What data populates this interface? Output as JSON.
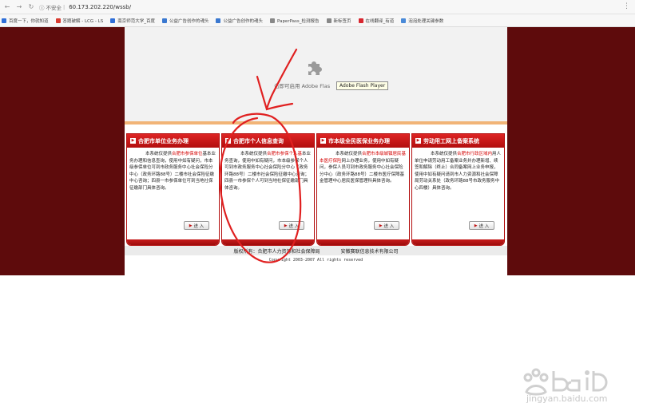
{
  "browser": {
    "security_label": "不安全",
    "url": "60.173.202.220/wssb/",
    "bookmarks": [
      {
        "label": "百度一下，你就知道",
        "color": "#2f6fd8"
      },
      {
        "label": "答题破解 - LCG - LS",
        "color": "#d83a2f"
      },
      {
        "label": "南京师范大学_百度",
        "color": "#2f6fd8"
      },
      {
        "label": "公益广告创作的魂头",
        "color": "#3a78d0"
      },
      {
        "label": "公益广告创作的魂头",
        "color": "#3a78d0"
      },
      {
        "label": "PaperPass_检测报告",
        "color": "#888888"
      },
      {
        "label": "新标签页",
        "color": "#888888"
      },
      {
        "label": "在线翻译_有道",
        "color": "#d8262f"
      },
      {
        "label": "泡泡处理关键参数",
        "color": "#4a8ad8"
      }
    ]
  },
  "flash": {
    "text": "击即可启用 Adobe Flas",
    "tooltip": "Adobe Flash Player"
  },
  "panels": [
    {
      "title": "合肥市单位业务办理",
      "body_pre": "本系统仅提供",
      "body_highlight": "合肥市参保单位",
      "body_post": "基本业务办理和信息查询，使用中如有疑问，市本级参保单位可到市政务服务中心社会保险分中心（政务环路88号）二楼市社会保险征缴中心咨询；四县一市参保单位可到当地社保征缴部门具体咨询。",
      "button": "进 入"
    },
    {
      "title": "合肥市个人信息查询",
      "body_pre": "本系统仅提供",
      "body_highlight": "合肥市参保个人基",
      "body_post": "本业务查询，使用中如有疑问，市本级参保个人可到市政务服务中心社会保险分中心（政务环路88号）二楼市社会保险征缴中心咨询；四县一市参保个人可到当地社保征缴部门具体咨询。",
      "button": "进 入"
    },
    {
      "title": "市本级全民医保业务办理",
      "body_pre": "本系统仅提供",
      "body_highlight": "合肥市本级城镇居民基本医疗保险",
      "body_post": "网上办理业务，使用中如有疑问，参保人员可到市政务服务中心社会保险分中心（政务环路88号）二楼市医疗保障基金管理中心居民医保管理科具体咨询。",
      "button": "进 入"
    },
    {
      "title": "劳动用工网上备案系统",
      "body_pre": "本系统仅提供",
      "body_highlight": "合肥市行政区域内",
      "body_post": "用人单位申请劳动用工备案业务并办理新增、续签和解除（终止）合同备案网上业务申报，使用中如有疑问请到市人力资源和社会保障局劳动关系处（政务环路88号市政务服务中心四楼）具体咨询。",
      "button": "进 入"
    }
  ],
  "footer": {
    "left": "版权所有：合肥市人力资源和社会保障局",
    "right": "安徽赛联信息技术有限公司",
    "copyright": "Copyright 2003-2007 All rights reserved"
  },
  "watermark": {
    "site": "jingyan.baidu.com"
  }
}
